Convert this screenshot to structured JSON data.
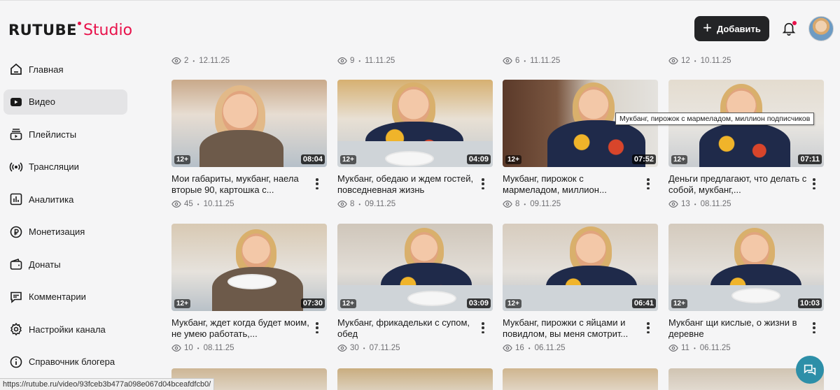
{
  "header": {
    "logo_main": "RUTUBE",
    "logo_studio": "Studio",
    "add_button": "Добавить"
  },
  "sidebar": {
    "items": [
      {
        "label": "Главная",
        "icon": "home-icon",
        "active": false
      },
      {
        "label": "Видео",
        "icon": "video-icon",
        "active": true
      },
      {
        "label": "Плейлисты",
        "icon": "playlist-icon",
        "active": false
      },
      {
        "label": "Трансляции",
        "icon": "broadcast-icon",
        "active": false
      },
      {
        "label": "Аналитика",
        "icon": "analytics-icon",
        "active": false
      },
      {
        "label": "Монетизация",
        "icon": "ruble-icon",
        "active": false
      },
      {
        "label": "Донаты",
        "icon": "wallet-icon",
        "active": false
      },
      {
        "label": "Комментарии",
        "icon": "comment-icon",
        "active": false
      },
      {
        "label": "Настройки канала",
        "icon": "gear-icon",
        "active": false
      },
      {
        "label": "Справочник блогера",
        "icon": "help-icon",
        "active": false
      }
    ]
  },
  "top_row_meta": [
    {
      "views": "2",
      "date": "12.11.25"
    },
    {
      "views": "9",
      "date": "11.11.25"
    },
    {
      "views": "6",
      "date": "11.11.25"
    },
    {
      "views": "12",
      "date": "10.11.25"
    }
  ],
  "videos_row1": [
    {
      "title": "Мои габариты, мукбанг, наела вторые 90, картошка с...",
      "age": "12+",
      "duration": "08:04",
      "views": "45",
      "date": "10.11.25"
    },
    {
      "title": "Мукбанг, обедаю и ждем гостей, повседневная жизнь",
      "age": "12+",
      "duration": "04:09",
      "views": "8",
      "date": "09.11.25"
    },
    {
      "title": "Мукбанг, пирожок с мармеладом, миллион...",
      "age": "12+",
      "duration": "07:52",
      "views": "8",
      "date": "09.11.25"
    },
    {
      "title": "Деньги предлагают, что делать с собой, мукбанг,...",
      "age": "12+",
      "duration": "07:11",
      "views": "13",
      "date": "08.11.25"
    }
  ],
  "videos_row2": [
    {
      "title": "Мукбанг, ждет когда будет моим, не умею работать,...",
      "age": "12+",
      "duration": "07:30",
      "views": "10",
      "date": "08.11.25"
    },
    {
      "title": "Мукбанг, фрикадельки с супом, обед",
      "age": "12+",
      "duration": "03:09",
      "views": "30",
      "date": "07.11.25"
    },
    {
      "title": "Мукбанг, пирожки с яйцами и повидлом, вы меня смотрит...",
      "age": "12+",
      "duration": "06:41",
      "views": "16",
      "date": "06.11.25"
    },
    {
      "title": "Мукбанг щи кислые, о жизни в деревне",
      "age": "12+",
      "duration": "10:03",
      "views": "11",
      "date": "06.11.25"
    }
  ],
  "tooltip": "Мукбанг, пирожок с мармеладом, миллион подписчиков",
  "status_url": "https://rutube.ru/video/93fceb3b477a098e067d04bceafdfcb0/",
  "colors": {
    "accent": "#e8124b",
    "button_dark": "#232426",
    "chat": "#2d8fa8"
  }
}
